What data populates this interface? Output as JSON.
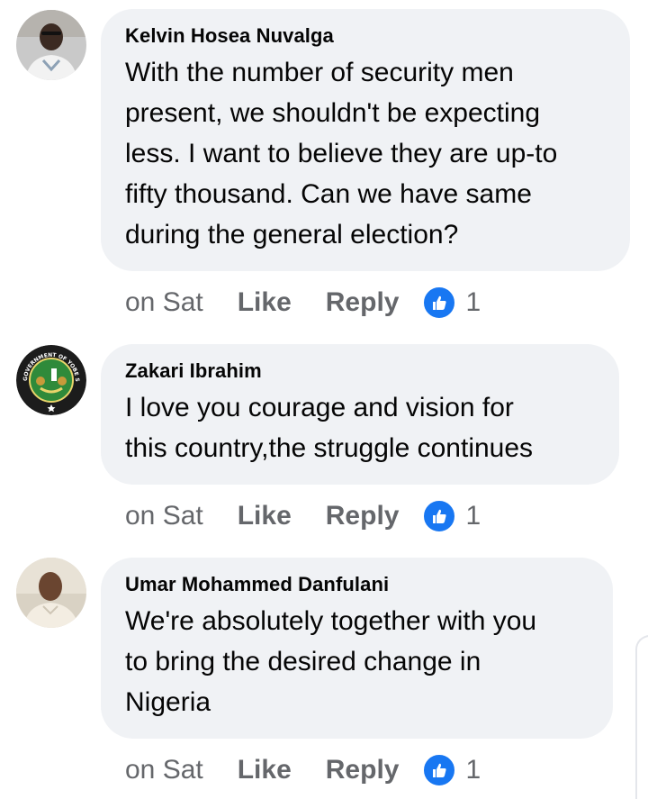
{
  "comments": [
    {
      "author": "Kelvin Hosea Nuvalga",
      "text": "With the number of security men present, we shouldn't be expecting less. I want to believe they are up-to fifty thousand. Can we have same during the general election?",
      "lines": [
        "With the number of security men",
        "present, we shouldn't be expecting",
        "less. I want to believe they are up-to",
        "fifty thousand. Can we have same",
        "during the general election?"
      ],
      "time": "on Sat",
      "like_label": "Like",
      "reply_label": "Reply",
      "reaction_count": "1",
      "avatar_icon": "person-photo-icon"
    },
    {
      "author": "Zakari Ibrahim",
      "text": "I love you courage and vision for this country,the struggle continues",
      "lines": [
        "I love you courage and vision for",
        "this country,the struggle continues"
      ],
      "time": "on Sat",
      "like_label": "Like",
      "reply_label": "Reply",
      "reaction_count": "1",
      "avatar_icon": "government-seal-icon"
    },
    {
      "author": "Umar Mohammed Danfulani",
      "text": "We're absolutely together with you to bring the desired change in Nigeria",
      "lines": [
        "We're absolutely together with you",
        "to bring the desired change in",
        "Nigeria"
      ],
      "time": "on Sat",
      "like_label": "Like",
      "reply_label": "Reply",
      "reaction_count": "1",
      "avatar_icon": "person-photo-icon"
    }
  ],
  "seal_text": "GOVERNMENT OF YOBE STATE",
  "colors": {
    "bubble": "#f0f2f5",
    "meta_text": "#65676b",
    "like_badge": "#1877f2"
  }
}
